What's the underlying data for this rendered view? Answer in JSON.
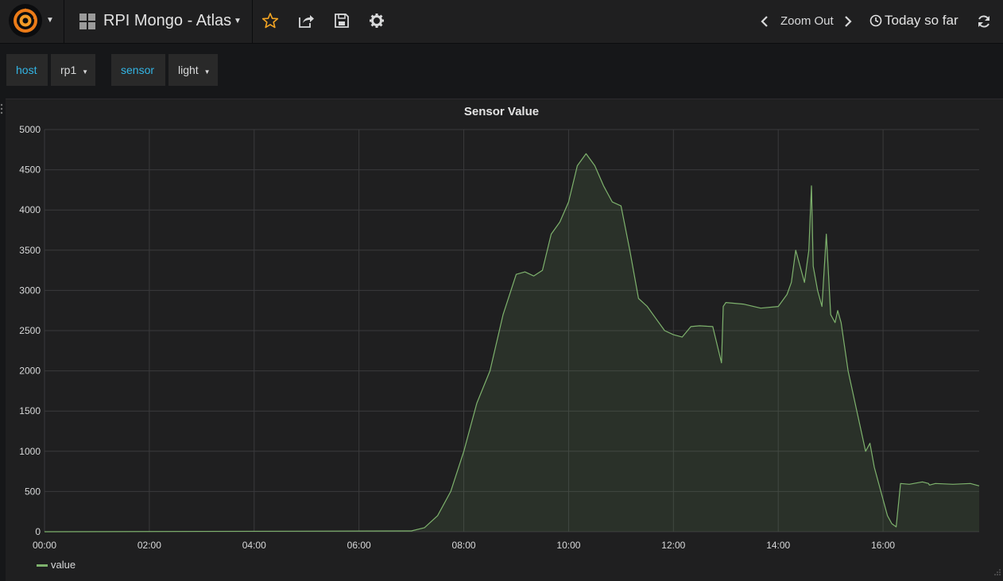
{
  "navbar": {
    "dashboard_title": "RPI Mongo - Atlas",
    "zoom_out_label": "Zoom Out",
    "time_range_label": "Today so far",
    "logo_icon": "grafana-logo-icon",
    "icons": [
      "star-icon",
      "share-icon",
      "save-icon",
      "gear-icon",
      "refresh-icon"
    ],
    "accent_color": "#eb7b18",
    "star_color": "#f5a623"
  },
  "variables": [
    {
      "label": "host",
      "value": "rp1"
    },
    {
      "label": "sensor",
      "value": "light"
    }
  ],
  "panel": {
    "title": "Sensor Value"
  },
  "chart_data": {
    "type": "area",
    "title": "Sensor Value",
    "xlabel": "",
    "ylabel": "",
    "x_ticks": [
      "00:00",
      "02:00",
      "04:00",
      "06:00",
      "08:00",
      "10:00",
      "12:00",
      "14:00",
      "16:00"
    ],
    "y_ticks": [
      "0",
      "500",
      "1000",
      "1500",
      "2000",
      "2500",
      "3000",
      "3500",
      "4000",
      "4500",
      "5000"
    ],
    "xlim": [
      "00:00",
      "17:50"
    ],
    "ylim": [
      0,
      5000
    ],
    "grid": true,
    "legend_position": "bottom-left",
    "series": [
      {
        "name": "value",
        "color": "#7eb26d",
        "x": [
          "00:00",
          "07:00",
          "07:15",
          "07:30",
          "07:45",
          "08:00",
          "08:15",
          "08:30",
          "08:45",
          "09:00",
          "09:10",
          "09:20",
          "09:30",
          "09:40",
          "09:50",
          "10:00",
          "10:10",
          "10:20",
          "10:30",
          "10:40",
          "10:50",
          "11:00",
          "11:10",
          "11:20",
          "11:30",
          "11:40",
          "11:50",
          "12:00",
          "12:10",
          "12:20",
          "12:30",
          "12:45",
          "12:55",
          "12:57",
          "13:00",
          "13:20",
          "13:40",
          "14:00",
          "14:10",
          "14:15",
          "14:20",
          "14:25",
          "14:30",
          "14:35",
          "14:38",
          "14:40",
          "14:45",
          "14:50",
          "14:55",
          "15:00",
          "15:05",
          "15:08",
          "15:12",
          "15:20",
          "15:30",
          "15:40",
          "15:45",
          "15:50",
          "16:00",
          "16:05",
          "16:10",
          "16:15",
          "16:20",
          "16:30",
          "16:45",
          "16:52",
          "16:53",
          "17:00",
          "17:20",
          "17:40",
          "17:50"
        ],
        "values": [
          0,
          10,
          50,
          200,
          500,
          1000,
          1600,
          2000,
          2700,
          3200,
          3230,
          3180,
          3250,
          3700,
          3850,
          4100,
          4550,
          4700,
          4550,
          4300,
          4100,
          4050,
          3500,
          2900,
          2800,
          2650,
          2500,
          2450,
          2420,
          2550,
          2560,
          2550,
          2100,
          2800,
          2850,
          2830,
          2780,
          2800,
          2950,
          3100,
          3500,
          3300,
          3100,
          3500,
          4300,
          3300,
          3000,
          2800,
          3700,
          2700,
          2600,
          2750,
          2600,
          2000,
          1500,
          1000,
          1100,
          800,
          400,
          200,
          100,
          60,
          600,
          590,
          620,
          600,
          580,
          600,
          590,
          600,
          570
        ]
      }
    ]
  }
}
